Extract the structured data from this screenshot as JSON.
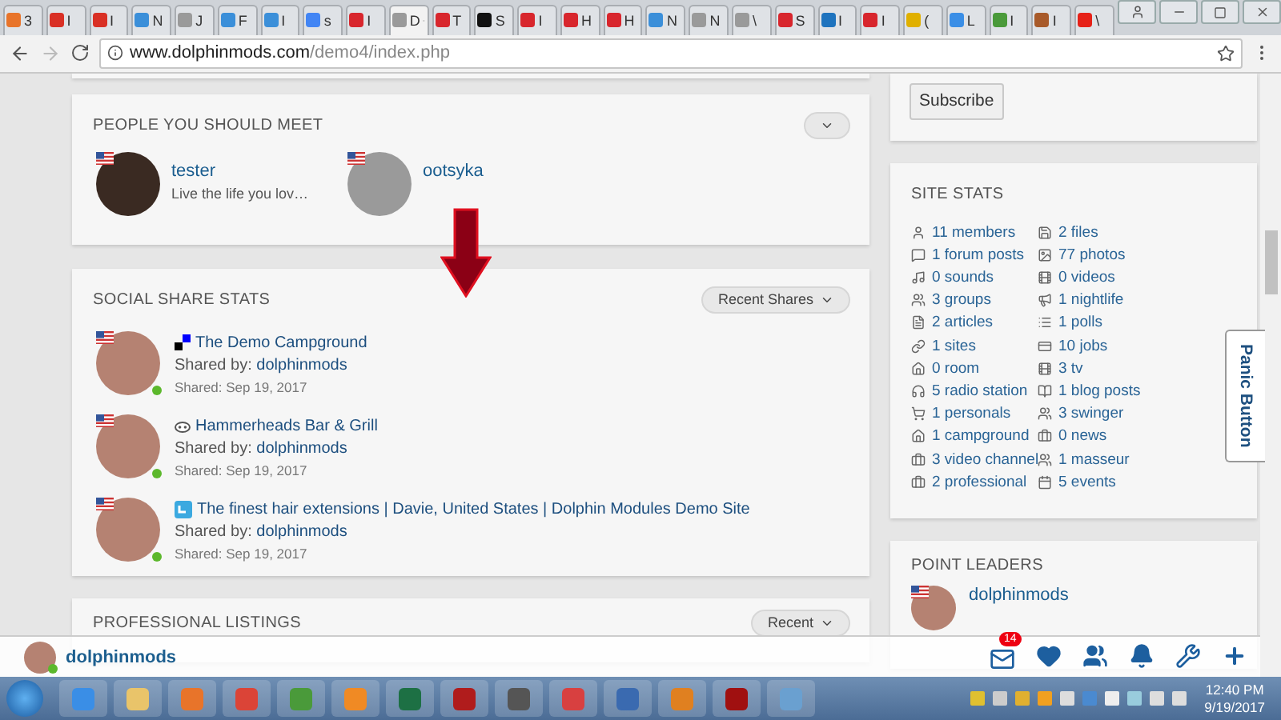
{
  "browser": {
    "tabs": [
      {
        "label": "3",
        "color": "#e8742a",
        "selected": false
      },
      {
        "label": "I",
        "color": "#d93025",
        "selected": false
      },
      {
        "label": "I",
        "color": "#d93025",
        "selected": false
      },
      {
        "label": "N",
        "color": "#3b8fd9",
        "selected": false
      },
      {
        "label": "J",
        "color": "#9a9a9a",
        "selected": false
      },
      {
        "label": "F",
        "color": "#3b8fd9",
        "selected": false
      },
      {
        "label": "I",
        "color": "#3b8fd9",
        "selected": false
      },
      {
        "label": "s",
        "color": "#4285f4",
        "selected": false
      },
      {
        "label": "I",
        "color": "#d8262d",
        "selected": false
      },
      {
        "label": "D",
        "color": "#9a9a9a",
        "selected": true
      },
      {
        "label": "T",
        "color": "#d8262d",
        "selected": false
      },
      {
        "label": "S",
        "color": "#111111",
        "selected": false
      },
      {
        "label": "I",
        "color": "#d8262d",
        "selected": false
      },
      {
        "label": "H",
        "color": "#d8262d",
        "selected": false
      },
      {
        "label": "H",
        "color": "#d8262d",
        "selected": false
      },
      {
        "label": "N",
        "color": "#3b8fd9",
        "selected": false
      },
      {
        "label": "N",
        "color": "#9a9a9a",
        "selected": false
      },
      {
        "label": "\\",
        "color": "#9a9a9a",
        "selected": false
      },
      {
        "label": "S",
        "color": "#d8262d",
        "selected": false
      },
      {
        "label": "I",
        "color": "#1e73be",
        "selected": false
      },
      {
        "label": "I",
        "color": "#d8262d",
        "selected": false
      },
      {
        "label": "(",
        "color": "#e0b000",
        "selected": false
      },
      {
        "label": "L",
        "color": "#3a8ee6",
        "selected": false
      },
      {
        "label": "I",
        "color": "#4a9a3a",
        "selected": false
      },
      {
        "label": "I",
        "color": "#a85a2a",
        "selected": false
      },
      {
        "label": "\\",
        "color": "#e62117",
        "selected": false
      }
    ],
    "url_host": "www.dolphinmods.com",
    "url_path": "/demo4/index.php"
  },
  "subscribe": {
    "button": "Subscribe"
  },
  "people": {
    "title": "PEOPLE YOU SHOULD MEET",
    "members": [
      {
        "name": "tester",
        "status": "Live the life you lov…"
      },
      {
        "name": "ootsyka"
      }
    ]
  },
  "social_share": {
    "title": "SOCIAL SHARE STATS",
    "filter": "Recent Shares",
    "shares": [
      {
        "title": "The Demo Campground",
        "shared_by_label": "Shared by:",
        "shared_by": "dolphinmods",
        "date": "Shared: Sep 19, 2017",
        "online": true
      },
      {
        "title": "Hammerheads Bar & Grill",
        "shared_by_label": "Shared by:",
        "shared_by": "dolphinmods",
        "date": "Shared: Sep 19, 2017",
        "online": true
      },
      {
        "title": "The finest hair extensions | Davie, United States | Dolphin Modules Demo Site",
        "shared_by_label": "Shared by:",
        "shared_by": "dolphinmods",
        "date": "Shared: Sep 19, 2017",
        "online": true
      }
    ]
  },
  "professional": {
    "title": "PROFESSIONAL LISTINGS",
    "filter": "Recent"
  },
  "site_stats": {
    "title": "SITE STATS",
    "items": [
      "11 members",
      "2 files",
      "1 forum posts",
      "77 photos",
      "0 sounds",
      "0 videos",
      "3 groups",
      "1 nightlife",
      "2 articles",
      "1 polls",
      "1 sites",
      "10 jobs",
      "0 room",
      "3 tv",
      "5 radio station",
      "1 blog posts",
      "1 personals",
      "3 swinger",
      "1 campground",
      "0 news",
      "3 video channel",
      "1 masseur",
      "2 professional",
      "5 events"
    ]
  },
  "point_leaders": {
    "title": "POINT LEADERS",
    "leader": "dolphinmods"
  },
  "panic_button": "Panic Button",
  "bottom_bar": {
    "user": "dolphinmods",
    "online": true,
    "mail_count": "14"
  },
  "taskbar": {
    "time": "12:40 PM",
    "date": "9/19/2017"
  }
}
